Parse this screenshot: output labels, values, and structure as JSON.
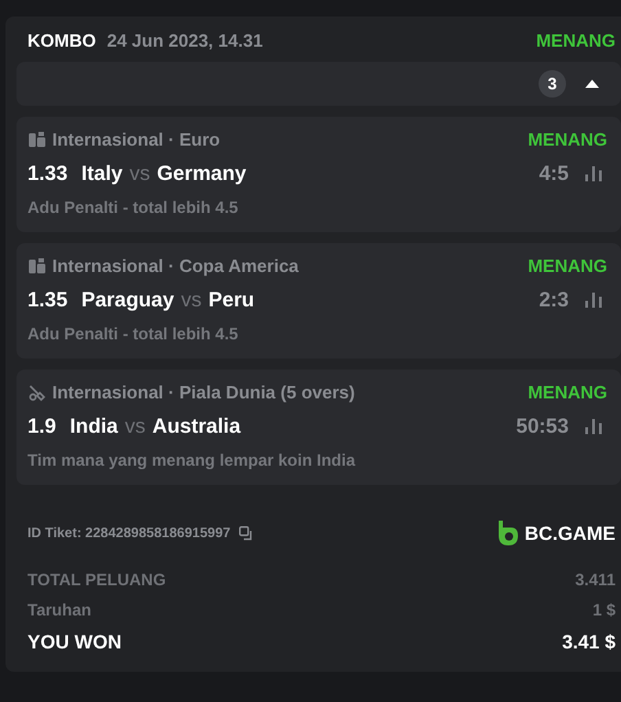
{
  "ticket": {
    "type": "KOMBO",
    "date": "24 Jun 2023, 14.31",
    "status": "MENANG",
    "count": "3",
    "expanded": true
  },
  "bets": [
    {
      "kind": "football",
      "league": "Internasional · Euro",
      "status": "MENANG",
      "odds": "1.33",
      "home": "Italy",
      "vs": "vs",
      "away": "Germany",
      "score": "4:5",
      "market": "Adu Penalti - total lebih 4.5"
    },
    {
      "kind": "football",
      "league": "Internasional · Copa America",
      "status": "MENANG",
      "odds": "1.35",
      "home": "Paraguay",
      "vs": "vs",
      "away": "Peru",
      "score": "2:3",
      "market": "Adu Penalti - total lebih 4.5"
    },
    {
      "kind": "cricket",
      "league": "Internasional · Piala Dunia (5 overs)",
      "status": "MENANG",
      "odds": "1.9",
      "home": "India",
      "vs": "vs",
      "away": "Australia",
      "score": "50:53",
      "market": "Tim mana yang menang lempar koin India"
    }
  ],
  "footer": {
    "ticket_id": "ID Tiket: 2284289858186915997",
    "brand": "BC.GAME",
    "totals": [
      {
        "kind": "plain",
        "label": "TOTAL PELUANG",
        "value": "3.411"
      },
      {
        "kind": "plain",
        "label": "Taruhan",
        "value": "1 $"
      },
      {
        "kind": "strong",
        "label": "YOU WON",
        "value": "3.41 $"
      }
    ]
  }
}
